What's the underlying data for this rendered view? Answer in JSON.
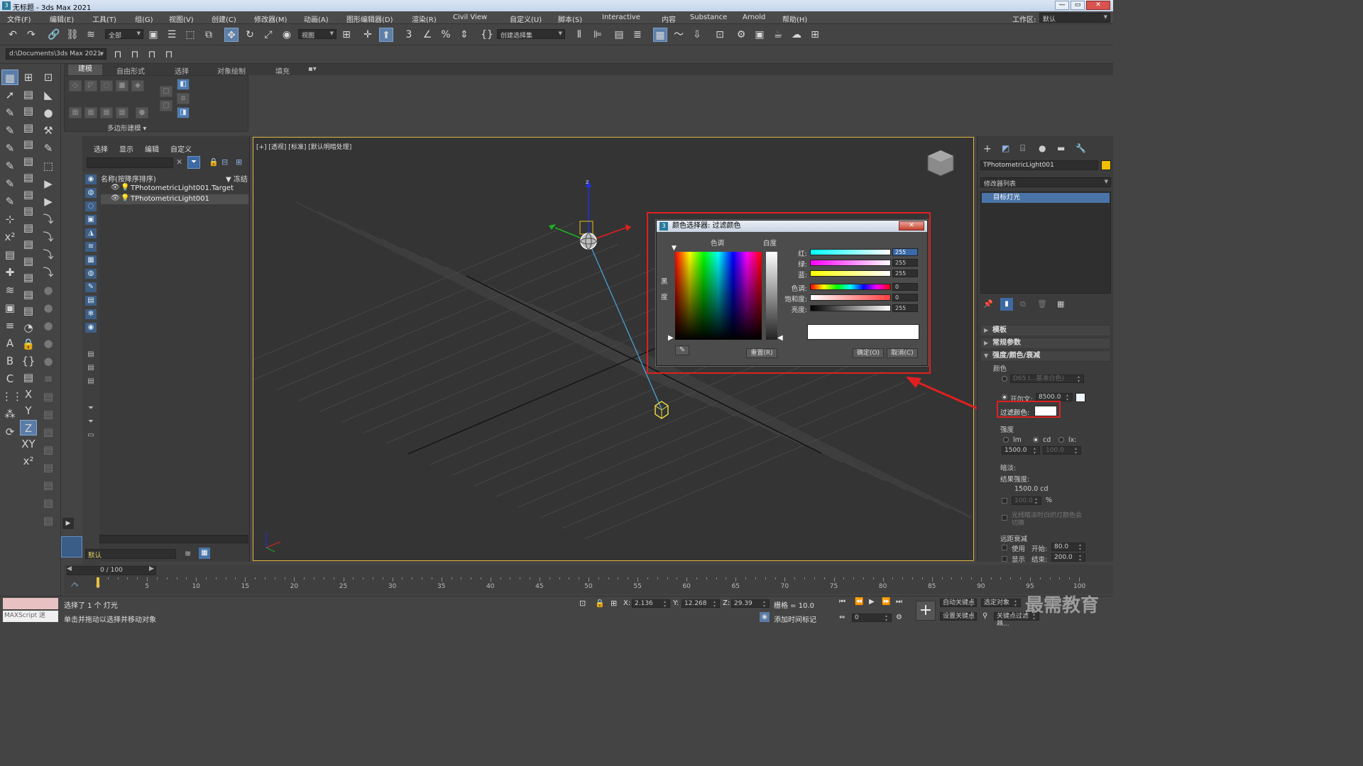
{
  "window": {
    "title": "无标题 - 3ds Max 2021",
    "app_icon": "3",
    "minimize": "—",
    "maximize": "▭",
    "close": "✕"
  },
  "menu": [
    "文件(F)",
    "编辑(E)",
    "工具(T)",
    "组(G)",
    "视图(V)",
    "创建(C)",
    "修改器(M)",
    "动画(A)",
    "图形编辑器(D)",
    "渲染(R)",
    "Civil View",
    "自定义(U)",
    "脚本(S)",
    "Interactive",
    "内容",
    "Substance",
    "Arnold",
    "帮助(H)"
  ],
  "workspace": {
    "label": "工作区:",
    "value": "默认"
  },
  "toolbar": {
    "selection_filter": "全部",
    "ref_coord": "视图",
    "named_selection": "创建选择集"
  },
  "project_path": "d:\\Documents\\3ds Max 2021",
  "ribbon": {
    "tabs": [
      "建模",
      "自由形式",
      "选择",
      "对象绘制",
      "填充"
    ],
    "group_label": "多边形建模"
  },
  "scene_explorer": {
    "menu": [
      "选择",
      "显示",
      "编辑",
      "自定义"
    ],
    "column_name": "名称(按降序排序)",
    "column_frozen": "▼ 冻结",
    "items": [
      {
        "name": "TPhotometricLight001.Target",
        "selected": false
      },
      {
        "name": "TPhotometricLight001",
        "selected": true
      }
    ],
    "layer_value": "默认"
  },
  "viewport": {
    "label": "[+] [透视] [标准] [默认明暗处理]",
    "axis_z": "z"
  },
  "color_dialog": {
    "title": "颜色选择器: 过滤颜色",
    "hue_label": "色调",
    "whiteness_label": "白度",
    "blackness_label": "黑度",
    "rows": [
      {
        "label": "红:",
        "value": "255",
        "gradient": "linear-gradient(to right, #00ffff, #ffffff)"
      },
      {
        "label": "绿:",
        "value": "255",
        "gradient": "linear-gradient(to right, #ff00ff, #ffffff)"
      },
      {
        "label": "蓝:",
        "value": "255",
        "gradient": "linear-gradient(to right, #ffff00, #ffffff)"
      },
      {
        "label": "色调:",
        "value": "0",
        "gradient": "linear-gradient(to right, #f00, #ff0, #0f0, #0ff, #00f, #f0f, #f00)"
      },
      {
        "label": "饱和度:",
        "value": "0",
        "gradient": "linear-gradient(to right, #ffffff, #ff4040)"
      },
      {
        "label": "亮度:",
        "value": "255",
        "gradient": "linear-gradient(to right, #000000, #ffffff)"
      }
    ],
    "reset_label": "重置(R)",
    "ok_label": "确定(O)",
    "cancel_label": "取消(C)",
    "preview_color": "#ffffff"
  },
  "command_panel": {
    "object_name": "TPhotometricLight001",
    "object_color": "#f0c000",
    "modifier_list": "修改器列表",
    "stack_item": "目标灯光",
    "sections": {
      "templates": "模板",
      "general": "常规参数",
      "intensity": "强度/颜色/衰减"
    },
    "color_label": "颜色",
    "preset_value": "D65 I...基准白色)",
    "kelvin_label": "开尔文:",
    "kelvin_value": "8500.0",
    "filter_color_label": "过滤颜色:",
    "intensity_label": "强度",
    "unit_lm": "lm",
    "unit_cd": "cd",
    "unit_lx": "lx:",
    "intensity_value": "1500.0",
    "lx_value": "100.0",
    "dimming_label": "暗淡:",
    "result_label": "结果强度:",
    "result_value": "1500.0 cd",
    "percent_value": "100.0",
    "percent_sign": "%",
    "incandescent_note": "光线暗淡时白炽灯颜色会切换",
    "far_atten_label": "远距衰减",
    "use_label": "使用",
    "show_label": "显示",
    "start_label": "开始:",
    "start_value": "80.0",
    "end_label": "结束:",
    "end_value": "200.0"
  },
  "timeline": {
    "frame_counter": "0 / 100",
    "ticks": [
      "0",
      "5",
      "10",
      "15",
      "20",
      "25",
      "30",
      "35",
      "40",
      "45",
      "50",
      "55",
      "60",
      "65",
      "70",
      "75",
      "80",
      "85",
      "90",
      "95",
      "100"
    ]
  },
  "status": {
    "maxscript_label": "MAXScript 迷",
    "selected_text": "选择了 1 个 灯光",
    "hint_text": "单击并拖动以选择并移动对象",
    "x_label": "X:",
    "x_value": "2.136",
    "y_label": "Y:",
    "y_value": "12.268",
    "z_label": "Z:",
    "z_value": "29.39",
    "grid_text": "栅格 = 10.0",
    "add_tag": "添加时间标记",
    "auto_key": "自动关键点",
    "set_key": "设置关键点",
    "selected_object": "选定对象",
    "key_filter": "关键点过滤器...",
    "frame_value": "0",
    "watermark": "最需教育"
  }
}
